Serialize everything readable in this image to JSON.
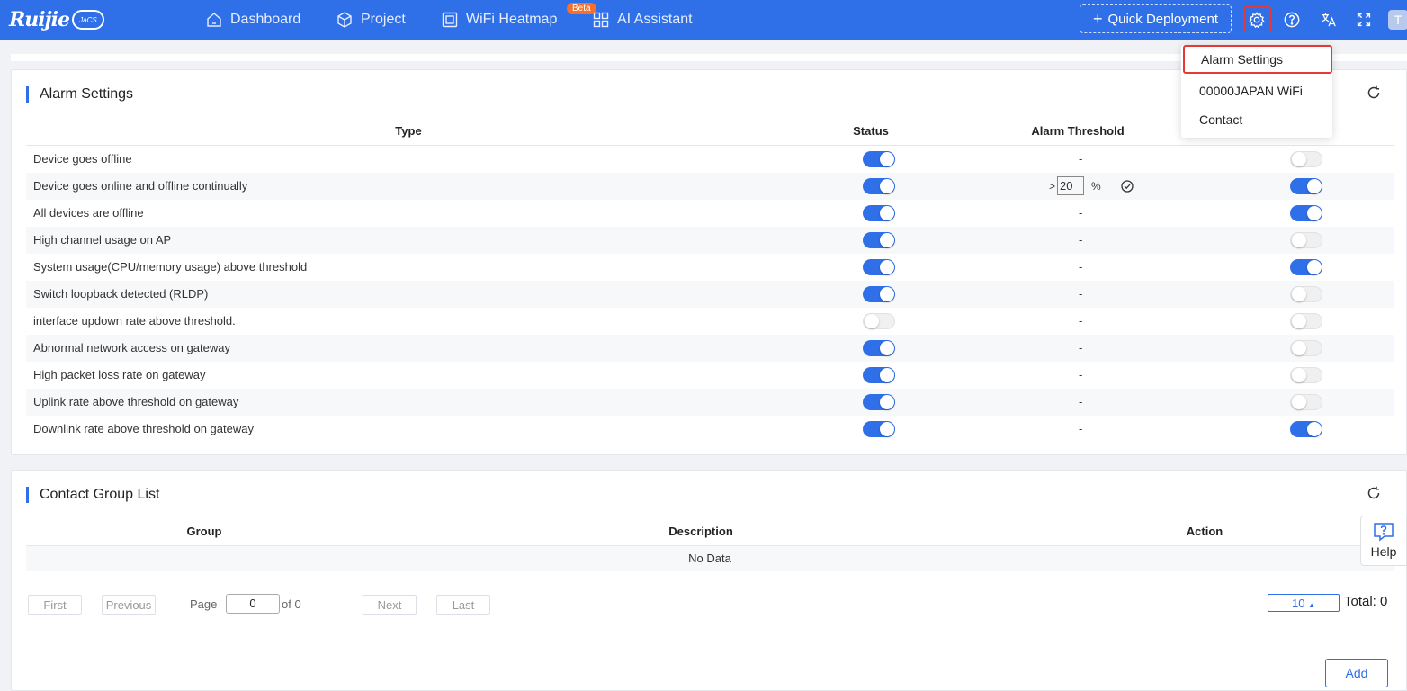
{
  "header": {
    "logo_text": "Ruijie",
    "logo_badge": "JaCS",
    "nav": [
      {
        "label": "Dashboard",
        "icon": "home-icon"
      },
      {
        "label": "Project",
        "icon": "cube-icon"
      },
      {
        "label": "WiFi Heatmap",
        "icon": "heatmap-icon"
      },
      {
        "label": "AI Assistant",
        "icon": "grid-icon"
      }
    ],
    "beta_badge": "Beta",
    "quick_deployment": "Quick Deployment",
    "avatar_initial": "T"
  },
  "settings_menu": {
    "items": [
      "Alarm Settings",
      "00000JAPAN WiFi",
      "Contact"
    ]
  },
  "alarm_settings": {
    "title": "Alarm Settings",
    "columns": {
      "type": "Type",
      "status": "Status",
      "threshold": "Alarm Threshold"
    },
    "threshold_prefix": ">",
    "threshold_value": "20",
    "threshold_unit": "%",
    "rows": [
      {
        "type": "Device goes offline",
        "status": true,
        "threshold": "-",
        "notify": false
      },
      {
        "type": "Device goes online and offline continually",
        "status": true,
        "threshold": "",
        "notify": true
      },
      {
        "type": "All devices are offline",
        "status": true,
        "threshold": "-",
        "notify": true
      },
      {
        "type": "High channel usage on AP",
        "status": true,
        "threshold": "-",
        "notify": false
      },
      {
        "type": "System usage(CPU/memory usage) above threshold",
        "status": true,
        "threshold": "-",
        "notify": true
      },
      {
        "type": "Switch loopback detected (RLDP)",
        "status": true,
        "threshold": "-",
        "notify": false
      },
      {
        "type": "interface updown rate above threshold.",
        "status": false,
        "threshold": "-",
        "notify": false
      },
      {
        "type": "Abnormal network access on gateway",
        "status": true,
        "threshold": "-",
        "notify": false
      },
      {
        "type": "High packet loss rate on gateway",
        "status": true,
        "threshold": "-",
        "notify": false
      },
      {
        "type": "Uplink rate above threshold on gateway",
        "status": true,
        "threshold": "-",
        "notify": false
      },
      {
        "type": "Downlink rate above threshold on gateway",
        "status": true,
        "threshold": "-",
        "notify": true
      }
    ]
  },
  "contact_group": {
    "title": "Contact Group List",
    "columns": {
      "group": "Group",
      "description": "Description",
      "action": "Action"
    },
    "empty_text": "No Data",
    "pagination": {
      "first": "First",
      "previous": "Previous",
      "page_label": "Page",
      "page_value": "0",
      "of_label": "of 0",
      "next": "Next",
      "last": "Last",
      "page_size": "10",
      "total": "Total: 0"
    },
    "add": "Add"
  },
  "help": {
    "label": "Help"
  },
  "colors": {
    "primary": "#2f6fe8",
    "highlight": "#e53935",
    "beta": "#f5702b"
  }
}
